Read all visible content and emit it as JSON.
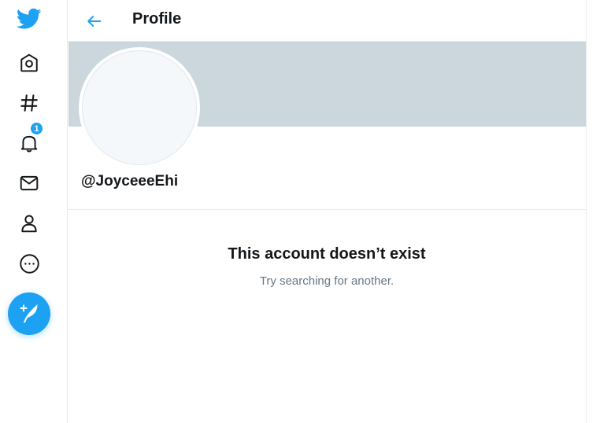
{
  "header": {
    "title": "Profile"
  },
  "nav": {
    "items": [
      {
        "name": "twitter-logo"
      },
      {
        "name": "home"
      },
      {
        "name": "explore"
      },
      {
        "name": "notifications",
        "badge": "1"
      },
      {
        "name": "messages"
      },
      {
        "name": "profile"
      },
      {
        "name": "more"
      }
    ],
    "tweet_button": "compose-tweet"
  },
  "profile": {
    "handle": "@JoyceeeEhi"
  },
  "empty_state": {
    "title": "This account doesn’t exist",
    "subtitle": "Try searching for another."
  },
  "colors": {
    "accent": "#1da1f2",
    "banner": "#ccd6dd",
    "text": "#14171a",
    "secondary_text": "#657786"
  }
}
